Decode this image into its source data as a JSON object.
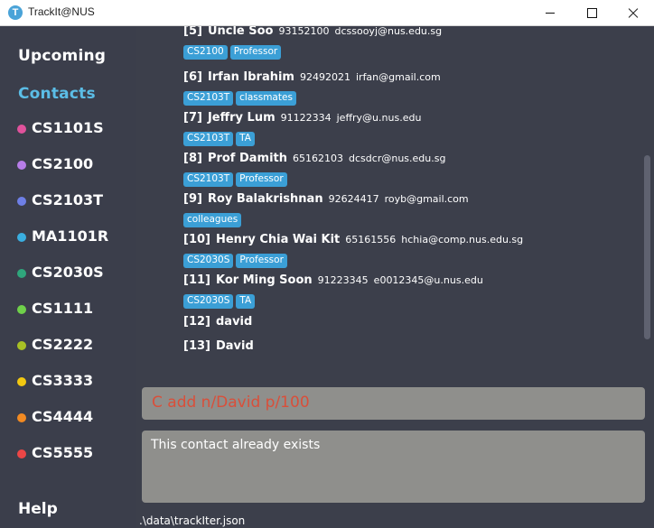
{
  "window": {
    "title": "TrackIt@NUS",
    "icon_letter": "T"
  },
  "sidebar": {
    "upcoming_label": "Upcoming",
    "contacts_label": "Contacts",
    "help_label": "Help",
    "modules": [
      {
        "code": "CS1101S",
        "color": "#e0529c"
      },
      {
        "code": "CS2100",
        "color": "#b77de8"
      },
      {
        "code": "CS2103T",
        "color": "#6e7fe6"
      },
      {
        "code": "MA1101R",
        "color": "#3aaee0"
      },
      {
        "code": "CS2030S",
        "color": "#2fa67c"
      },
      {
        "code": "CS1111",
        "color": "#6fd04a"
      },
      {
        "code": "CS2222",
        "color": "#a8c025"
      },
      {
        "code": "CS3333",
        "color": "#f2c811"
      },
      {
        "code": "CS4444",
        "color": "#f28a22"
      },
      {
        "code": "CS5555",
        "color": "#ec4646"
      }
    ]
  },
  "contacts": [
    {
      "index": "[5]",
      "name": "Uncle Soo",
      "phone": "93152100",
      "email": "dcssooyj@nus.edu.sg",
      "tags": [
        "CS2100",
        "Professor"
      ]
    },
    {
      "index": "[6]",
      "name": "Irfan Ibrahim",
      "phone": "92492021",
      "email": "irfan@gmail.com",
      "tags": [
        "CS2103T",
        "classmates"
      ]
    },
    {
      "index": "[7]",
      "name": "Jeffry Lum",
      "phone": "91122334",
      "email": "jeffry@u.nus.edu",
      "tags": [
        "CS2103T",
        "TA"
      ]
    },
    {
      "index": "[8]",
      "name": "Prof Damith",
      "phone": "65162103",
      "email": "dcsdcr@nus.edu.sg",
      "tags": [
        "CS2103T",
        "Professor"
      ]
    },
    {
      "index": "[9]",
      "name": "Roy Balakrishnan",
      "phone": "92624417",
      "email": "royb@gmail.com",
      "tags": [
        "colleagues"
      ]
    },
    {
      "index": "[10]",
      "name": "Henry Chia Wai Kit",
      "phone": "65161556",
      "email": "hchia@comp.nus.edu.sg",
      "tags": [
        "CS2030S",
        "Professor"
      ]
    },
    {
      "index": "[11]",
      "name": "Kor Ming Soon",
      "phone": "91223345",
      "email": "e0012345@u.nus.edu",
      "tags": [
        "CS2030S",
        "TA"
      ]
    },
    {
      "index": "[12]",
      "name": "david",
      "phone": "",
      "email": "",
      "tags": []
    },
    {
      "index": "[13]",
      "name": "David",
      "phone": "",
      "email": "",
      "tags": []
    }
  ],
  "command": {
    "value": "C add n/David p/100"
  },
  "result": {
    "message": "This contact already exists"
  },
  "status": {
    "path": ".\\data\\trackIter.json"
  }
}
